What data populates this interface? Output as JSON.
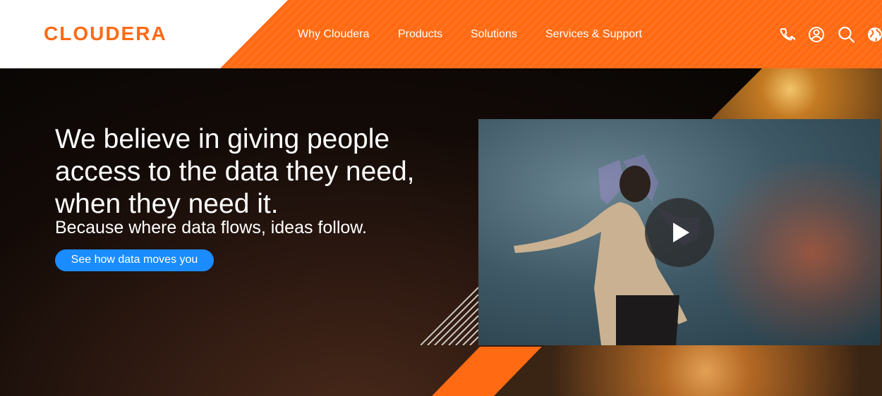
{
  "brand": {
    "logo_text": "CLOUDERA",
    "accent_color": "#ff6a13",
    "cta_color": "#1a8cff"
  },
  "nav": {
    "items": [
      {
        "label": "Why Cloudera"
      },
      {
        "label": "Products"
      },
      {
        "label": "Solutions"
      },
      {
        "label": "Services & Support"
      }
    ],
    "icons": [
      "phone-icon",
      "user-account-icon",
      "search-icon",
      "globe-icon"
    ]
  },
  "hero": {
    "headline": "We believe in giving people access to the data they need, when they need it.",
    "subheadline": "Because where data flows, ideas follow.",
    "cta_label": "See how data moves you"
  },
  "video": {
    "play_icon": "play-icon"
  }
}
